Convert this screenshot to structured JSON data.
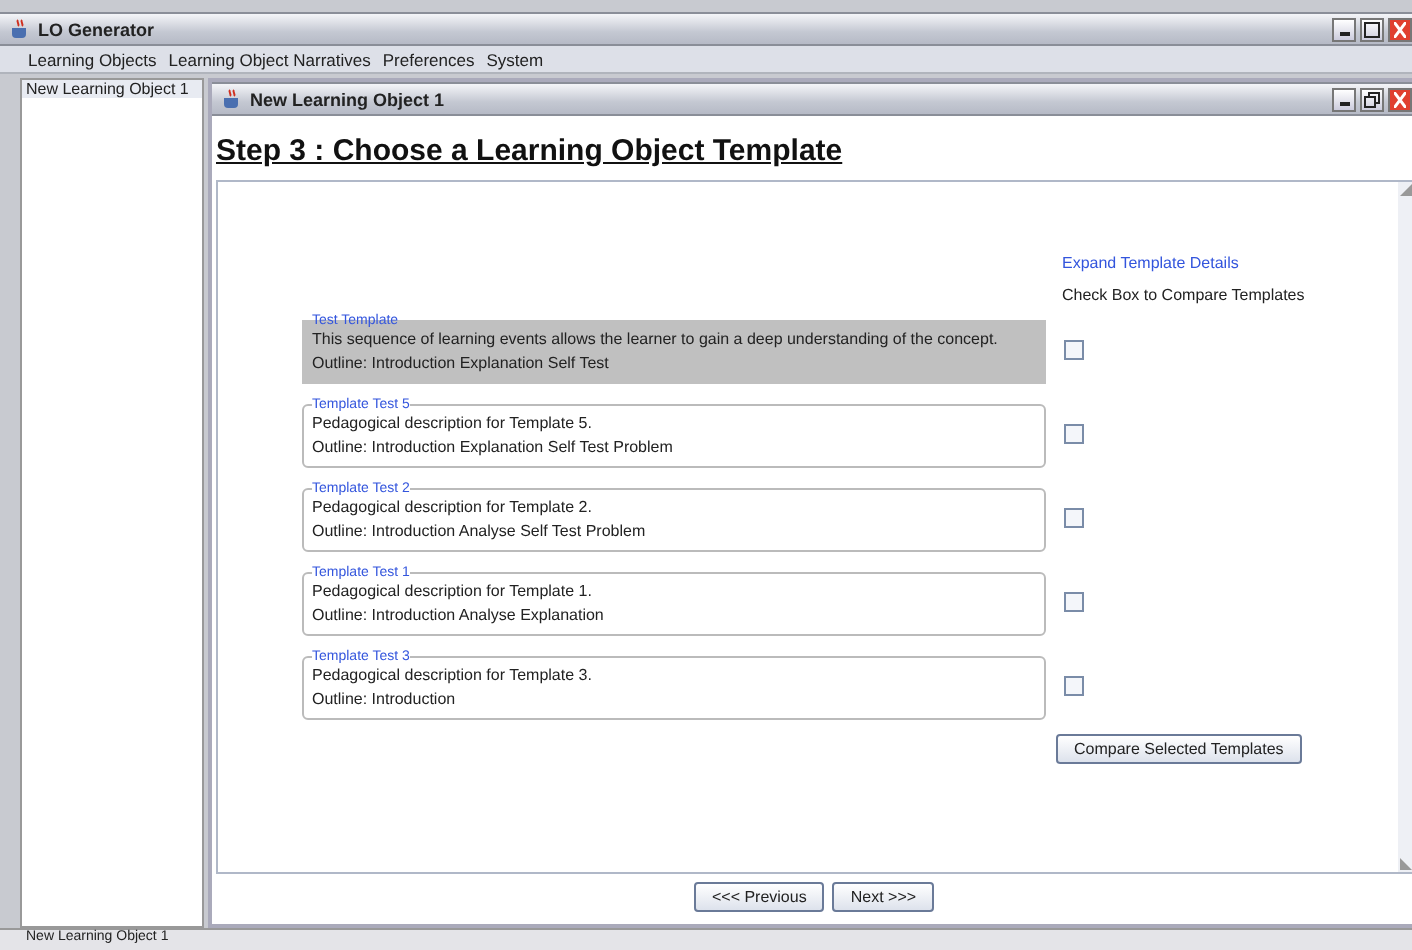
{
  "window": {
    "title": "LO Generator"
  },
  "menu": [
    "Learning Objects",
    "Learning Object Narratives",
    "Preferences",
    "System"
  ],
  "sidebar": {
    "items": [
      {
        "label": "New Learning Object 1",
        "selected": true
      }
    ]
  },
  "inner_window": {
    "title": "New Learning Object 1"
  },
  "heading": "Step 3 : Choose a Learning Object Template",
  "expand_link": "Expand Template Details",
  "compare_hint": "Check Box to Compare Templates",
  "templates": [
    {
      "title": "Test Template",
      "description": "This sequence of learning events allows the learner to gain a deep understanding of the concept.",
      "outline": "Outline: Introduction Explanation Self Test",
      "selected": true,
      "checked": false
    },
    {
      "title": "Template Test 5",
      "description": "Pedagogical description for Template 5.",
      "outline": "Outline: Introduction Explanation Self Test Problem",
      "selected": false,
      "checked": false
    },
    {
      "title": "Template Test 2",
      "description": "Pedagogical description for Template 2.",
      "outline": "Outline: Introduction Analyse Self Test Problem",
      "selected": false,
      "checked": false
    },
    {
      "title": "Template Test 1",
      "description": "Pedagogical description for Template 1.",
      "outline": "Outline: Introduction Analyse Explanation",
      "selected": false,
      "checked": false
    },
    {
      "title": "Template Test 3",
      "description": "Pedagogical description for Template 3.",
      "outline": "Outline: Introduction",
      "selected": false,
      "checked": false
    }
  ],
  "compare_button": "Compare Selected Templates",
  "nav_buttons": [
    "<<< Previous",
    "Next >>>"
  ],
  "status_bar": "New Learning Object 1"
}
